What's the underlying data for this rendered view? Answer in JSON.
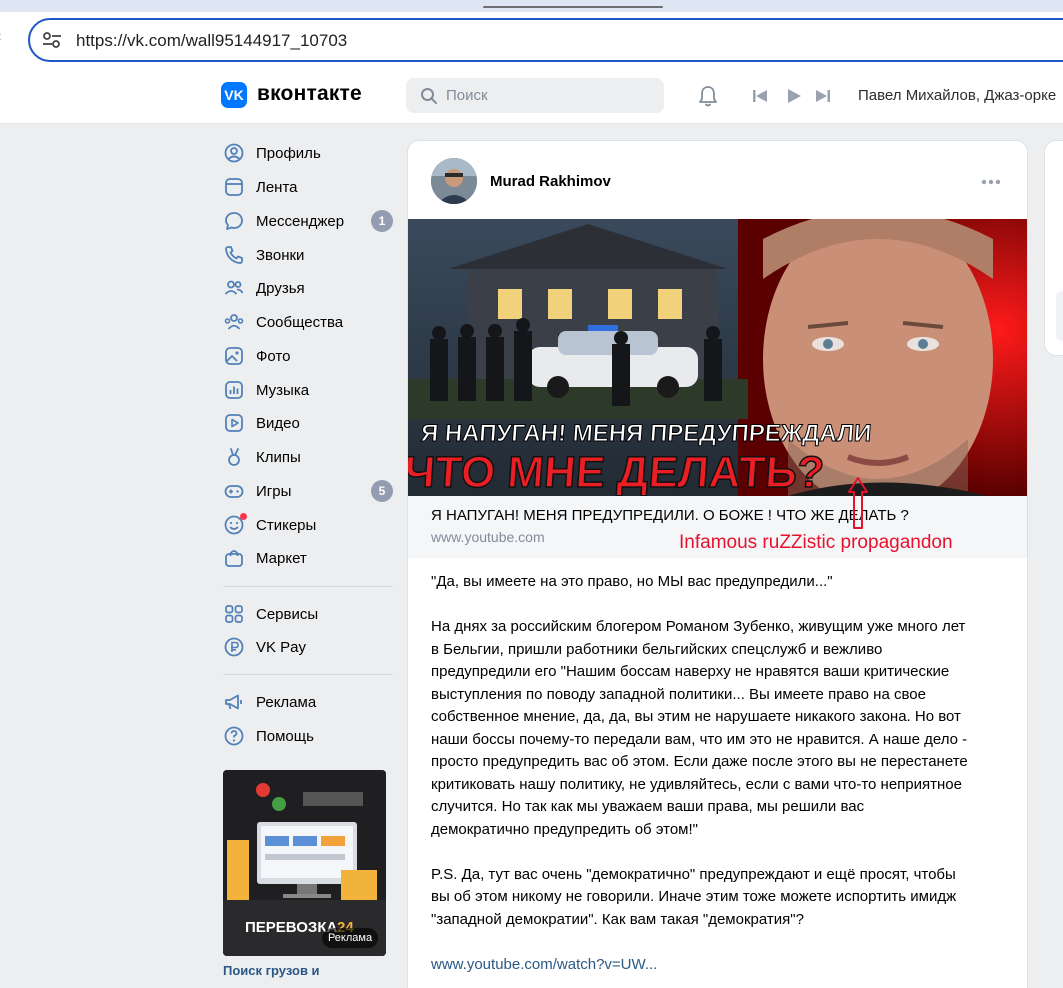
{
  "browser": {
    "url": "https://vk.com/wall95144917_10703"
  },
  "header": {
    "logo_text": "вконтакте",
    "search_placeholder": "Поиск",
    "now_playing": "Павел Михайлов, Джаз-орке"
  },
  "sidebar": {
    "items": [
      {
        "label": "Профиль",
        "icon": "profile-icon"
      },
      {
        "label": "Лента",
        "icon": "feed-icon"
      },
      {
        "label": "Мессенджер",
        "icon": "messenger-icon",
        "badge": "1"
      },
      {
        "label": "Звонки",
        "icon": "phone-icon"
      },
      {
        "label": "Друзья",
        "icon": "friends-icon"
      },
      {
        "label": "Сообщества",
        "icon": "communities-icon"
      },
      {
        "label": "Фото",
        "icon": "photo-icon"
      },
      {
        "label": "Музыка",
        "icon": "music-icon"
      },
      {
        "label": "Видео",
        "icon": "video-icon"
      },
      {
        "label": "Клипы",
        "icon": "clips-icon"
      },
      {
        "label": "Игры",
        "icon": "games-icon",
        "badge": "5"
      },
      {
        "label": "Стикеры",
        "icon": "stickers-icon"
      },
      {
        "label": "Маркет",
        "icon": "market-icon"
      },
      {
        "label": "Сервисы",
        "icon": "services-icon"
      },
      {
        "label": "VK Pay",
        "icon": "vkpay-icon"
      },
      {
        "label": "Реклама",
        "icon": "ads-icon"
      },
      {
        "label": "Помощь",
        "icon": "help-icon"
      }
    ],
    "ad": {
      "badge": "Реклама",
      "title": "Поиск грузов и",
      "brand": "ПЕРЕВОЗКА",
      "brand_num": "24"
    }
  },
  "post": {
    "author": "Murad Rakhimov",
    "thumbnail": {
      "line1": "Я НАПУГАН! МЕНЯ ПРЕДУПРЕЖДАЛИ",
      "line2": "ЧТО МНЕ ДЕЛАТЬ?"
    },
    "link_title": "Я НАПУГАН! МЕНЯ ПРЕДУПРЕДИЛИ. О БОЖЕ ! ЧТО ЖЕ ДЕЛАТЬ ?",
    "link_domain": "www.youtube.com",
    "annotation": "Infamous ruZZistic propagandon",
    "text_lines_1": [
      "\"Да, вы имеете на это право, но МЫ вас предупредили...\""
    ],
    "text_lines_2": [
      "На днях за российским блогером Романом Зубенко, живущим уже много лет",
      "в Бельгии, пришли работники бельгийских спецслужб и вежливо",
      "предупредили его \"Нашим боссам наверху не нравятся ваши критические",
      "выступления по поводу западной политики... Вы имеете право на свое",
      "собственное мнение, да, да, вы этим не нарушаете никакого закона. Но вот",
      "наши боссы почему-то передали вам, что им это не нравится. А наше дело -",
      "просто предупредить вас об этом. Если даже после этого вы не перестанете",
      "критиковать нашу политику, не удивляйтесь, если с вами что-то неприятное",
      "случится. Но так как мы уважаем ваши права, мы решили вас",
      "демократично предупредить об этом!\""
    ],
    "text_lines_3": [
      "P.S. Да, тут вас очень \"демократично\" предупреждают и ещё просят, чтобы",
      "вы об этом никому не говорили. Иначе этим тоже можете испортить имидж",
      "\"западной демократии\". Как вам такая \"демократия\"?"
    ],
    "link": "www.youtube.com/watch?v=UW..."
  },
  "colors": {
    "accent": "#0077ff",
    "link": "#2a5885",
    "annotation": "#e8112d"
  }
}
